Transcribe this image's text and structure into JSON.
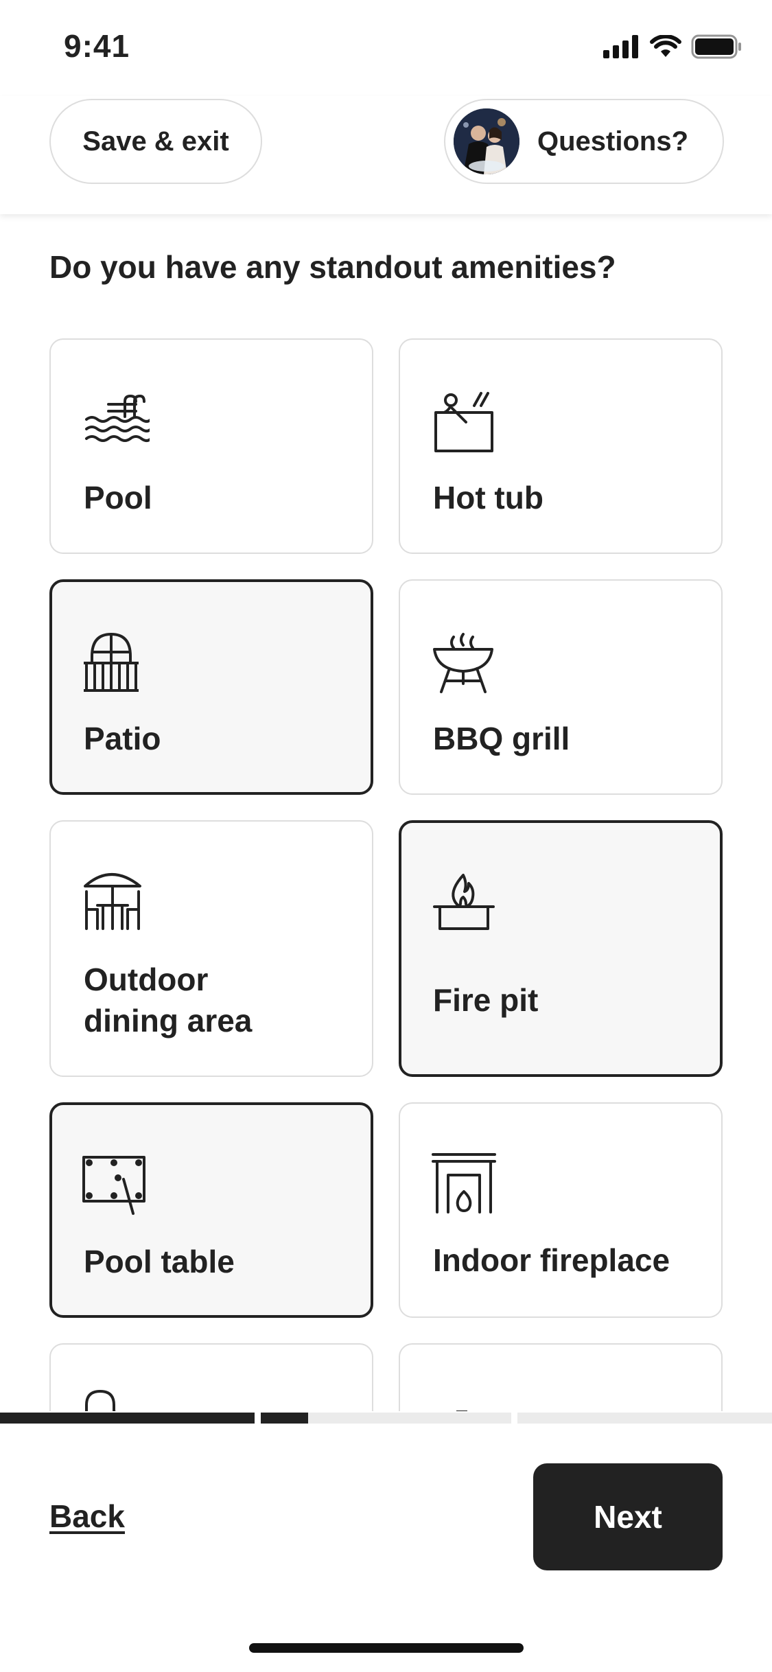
{
  "status_bar": {
    "time": "9:41"
  },
  "header": {
    "save_exit_label": "Save & exit",
    "questions_label": "Questions?"
  },
  "question": "Do you have any standout amenities?",
  "amenities": [
    {
      "label": "Pool",
      "icon": "pool-icon",
      "selected": false
    },
    {
      "label": "Hot tub",
      "icon": "hot-tub-icon",
      "selected": false
    },
    {
      "label": "Patio",
      "icon": "patio-icon",
      "selected": true
    },
    {
      "label": "BBQ grill",
      "icon": "bbq-grill-icon",
      "selected": false
    },
    {
      "label": "Outdoor\ndining area",
      "icon": "outdoor-dining-icon",
      "selected": false
    },
    {
      "label": "Fire pit",
      "icon": "fire-pit-icon",
      "selected": true
    },
    {
      "label": "Pool table",
      "icon": "pool-table-icon",
      "selected": true
    },
    {
      "label": "Indoor fireplace",
      "icon": "indoor-fireplace-icon",
      "selected": false
    }
  ],
  "progress": {
    "segments": [
      1.0,
      0.19,
      0.0
    ]
  },
  "footer": {
    "back_label": "Back",
    "next_label": "Next"
  },
  "colors": {
    "text": "#222222",
    "border": "#dddddd",
    "selected_bg": "#f7f7f7",
    "button": "#222222"
  }
}
